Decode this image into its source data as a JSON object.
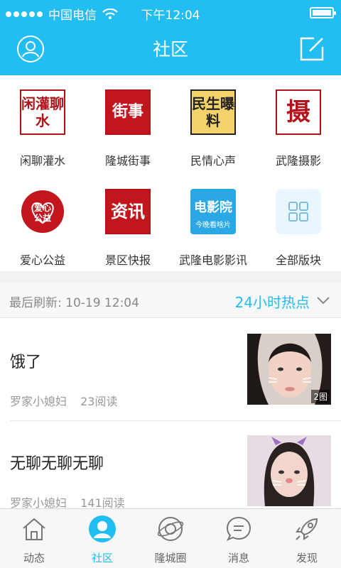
{
  "status": {
    "carrier": "中国电信",
    "time": "下午12:04"
  },
  "nav": {
    "title": "社区",
    "left_icon": "user-icon",
    "right_icon": "compose-icon"
  },
  "boards": [
    {
      "label": "闲聊灌水",
      "icon_text": "闲灌聊水"
    },
    {
      "label": "隆城街事",
      "icon_text": "街事"
    },
    {
      "label": "民情心声",
      "icon_text": "民生曝料"
    },
    {
      "label": "武隆摄影",
      "icon_text": "摄"
    },
    {
      "label": "爱心公益",
      "icon_text": "爱心公益"
    },
    {
      "label": "景区快报",
      "icon_text": "资讯"
    },
    {
      "label": "武隆电影影讯",
      "icon_text": "电影院",
      "icon_sub": "今晚看啥片"
    },
    {
      "label": "全部版块",
      "icon_text": ""
    }
  ],
  "feed": {
    "refresh_label": "最后刷新: 10-19  12:04",
    "hot_label": "24小时热点",
    "posts": [
      {
        "title": "饿了",
        "author": "罗家小媳妇",
        "reads": "23阅读",
        "image_count": "2图"
      },
      {
        "title": "无聊无聊无聊",
        "author": "罗家小媳妇",
        "reads": "141阅读"
      }
    ]
  },
  "tabs": [
    {
      "label": "动态",
      "icon": "home-icon"
    },
    {
      "label": "社区",
      "icon": "community-icon"
    },
    {
      "label": "隆城圈",
      "icon": "planet-icon"
    },
    {
      "label": "消息",
      "icon": "message-icon"
    },
    {
      "label": "发现",
      "icon": "rocket-icon"
    }
  ],
  "colors": {
    "accent": "#22bdf1",
    "seal_red": "#b3121b"
  }
}
